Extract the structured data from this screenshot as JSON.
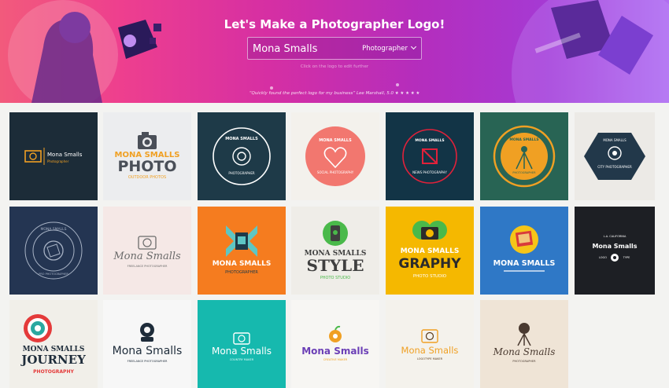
{
  "hero": {
    "title": "Let's Make a Photographer Logo!",
    "search_value": "Mona Smalls",
    "category": "Photographer",
    "hint": "Click on the logo to edit further",
    "quote": "“Quickly found the perfect logo for my business”",
    "quote_by": "Lee Marshall, 5.0",
    "stars": "★ ★ ★ ★ ★"
  },
  "logos": [
    {
      "name": "Mona Smalls",
      "sub": "Photographer"
    },
    {
      "name": "MONA SMALLS",
      "big": "PHOTO",
      "sub": "OUTDOOR PHOTOS"
    },
    {
      "name": "MONA SMALLS",
      "sub": "PHOTOGRAPHER"
    },
    {
      "name": "MONA SMALLS",
      "sub": "SOCIAL PHOTOGRAPHY"
    },
    {
      "name": "MONA SMALLS",
      "sub": "NEWS PHOTOGRAPHY"
    },
    {
      "name": "MONA SMALLS",
      "sub": "PHOTOGRAPHER"
    },
    {
      "name": "MONA SMALLS",
      "sub": "CITY PHOTOGRAPHER"
    },
    {
      "name": "MONA SMALLS",
      "sub": "PRO PHOTOGRAPHER"
    },
    {
      "name": "Mona Smalls",
      "sub": "FREELANCE PHOTOGRAPHER"
    },
    {
      "name": "MONA SMALLS",
      "sub": "PHOTOGRAPHER"
    },
    {
      "name": "MONA SMALLS",
      "big": "STYLE",
      "sub": "PHOTO STUDIO"
    },
    {
      "name": "MONA SMALLS",
      "big": "GRAPHY",
      "sub": "PHOTO STUDIO"
    },
    {
      "name": "MONA SMALLS",
      "sub": ""
    },
    {
      "name": "Mona Smalls",
      "top": "L.A. CALIFORNIA",
      "left": "LOGO",
      "right": "TYPE"
    },
    {
      "name": "MONA SMALLS",
      "big": "JOURNEY",
      "sub": "PHOTOGRAPHY"
    },
    {
      "name": "Mona Smalls",
      "sub": "FREELANCE PHOTOGRAPHER"
    },
    {
      "name": "Mona Smalls",
      "sub": "COUNTRY MAKER"
    },
    {
      "name": "Mona Smalls",
      "sub": "CREATIVE MAKER"
    },
    {
      "name": "Mona Smalls",
      "sub": "LOGOTYPE MAKER"
    },
    {
      "name": "Mona Smalls",
      "sub": "PHOTOGRAPHER"
    }
  ],
  "colors": {
    "orange": "#f0a023",
    "navy": "#182c3e",
    "teal": "#16b9ae",
    "pink": "#f5d9d6"
  }
}
